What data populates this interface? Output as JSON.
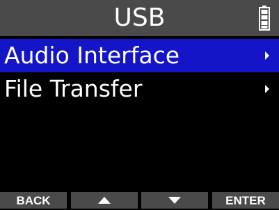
{
  "header": {
    "title": "USB",
    "battery_icon": "battery-full-icon"
  },
  "menu": {
    "items": [
      {
        "label": "Audio Interface",
        "selected": true,
        "icon": "chevron-right-icon"
      },
      {
        "label": "File Transfer",
        "selected": false,
        "icon": "chevron-right-icon"
      }
    ]
  },
  "softkeys": {
    "back_label": "BACK",
    "up_icon": "triangle-up-icon",
    "down_icon": "triangle-down-icon",
    "enter_label": "ENTER"
  },
  "colors": {
    "header_bg": "#4a4a4a",
    "selection": "#1414c8",
    "background": "#000000",
    "text": "#ffffff"
  }
}
